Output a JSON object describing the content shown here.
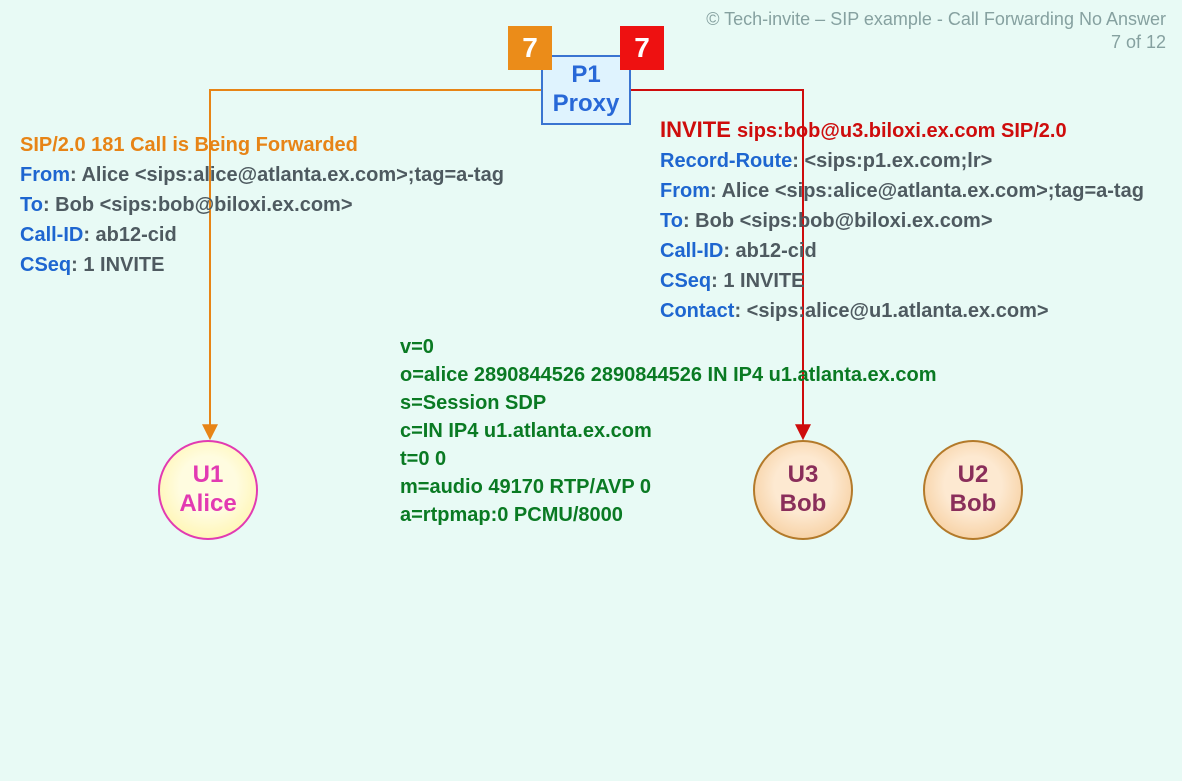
{
  "header": {
    "copyright": "© Tech-invite – SIP example - Call Forwarding No Answer",
    "page": "7 of 12"
  },
  "proxy": {
    "line1": "P1",
    "line2": "Proxy"
  },
  "steps": {
    "left": "7",
    "right": "7"
  },
  "left_msg": {
    "title": "SIP/2.0 181 Call is Being Forwarded",
    "from_k": "From",
    "from_v": ": Alice <sips:alice@atlanta.ex.com>;tag=a-tag",
    "to_k": "To",
    "to_v": ": Bob <sips:bob@biloxi.ex.com>",
    "cid_k": "Call-ID",
    "cid_v": ": ab12-cid",
    "cseq_k": "CSeq",
    "cseq_v": ": 1 INVITE"
  },
  "right_msg": {
    "method": "INVITE ",
    "uri": "sips:bob@u3.biloxi.ex.com SIP/2.0",
    "rr_k": "Record-Route",
    "rr_v": ": <sips:p1.ex.com;lr>",
    "from_k": "From",
    "from_v": ": Alice <sips:alice@atlanta.ex.com>;tag=a-tag",
    "to_k": "To",
    "to_v": ": Bob <sips:bob@biloxi.ex.com>",
    "cid_k": "Call-ID",
    "cid_v": ": ab12-cid",
    "cseq_k": "CSeq",
    "cseq_v": ": 1 INVITE",
    "contact_k": "Contact",
    "contact_v": ": <sips:alice@u1.atlanta.ex.com>"
  },
  "sdp": {
    "l1": "v=0",
    "l2": "o=alice  2890844526  2890844526  IN  IP4  u1.atlanta.ex.com",
    "l3": "s=Session SDP",
    "l4": "c=IN  IP4  u1.atlanta.ex.com",
    "l5": "t=0  0",
    "l6": "m=audio  49170  RTP/AVP  0",
    "l7": "a=rtpmap:0  PCMU/8000"
  },
  "nodes": {
    "alice": {
      "line1": "U1",
      "line2": "Alice"
    },
    "u3": {
      "line1": "U3",
      "line2": "Bob"
    },
    "u2": {
      "line1": "U2",
      "line2": "Bob"
    }
  }
}
